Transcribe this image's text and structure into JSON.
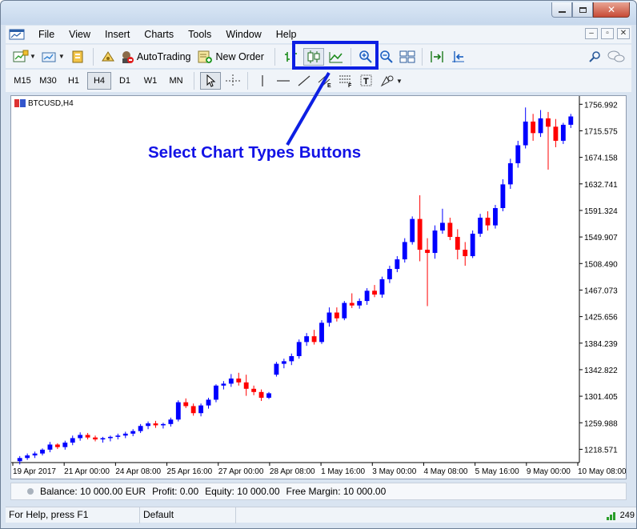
{
  "window": {
    "minimize_label": "–",
    "maximize_label": "□",
    "close_label": "✕"
  },
  "menubar": {
    "items": [
      "File",
      "View",
      "Insert",
      "Charts",
      "Tools",
      "Window",
      "Help"
    ]
  },
  "toolbar": {
    "autotrading_label": "AutoTrading",
    "new_order_label": "New Order"
  },
  "timeframes": [
    "M15",
    "M30",
    "H1",
    "H4",
    "D1",
    "W1",
    "MN"
  ],
  "active_timeframe": "H4",
  "chart": {
    "symbol_label": "BTCUSD,H4",
    "annotation": "Select Chart Types Buttons"
  },
  "chart_data": {
    "type": "candlestick",
    "title": "BTCUSD,H4",
    "y_ticks": [
      "1756.992",
      "1715.575",
      "1674.158",
      "1632.741",
      "1591.324",
      "1549.907",
      "1508.490",
      "1467.073",
      "1425.656",
      "1384.239",
      "1342.822",
      "1301.405",
      "1259.988",
      "1218.571"
    ],
    "x_ticks": [
      "19 Apr 2017",
      "21 Apr 00:00",
      "24 Apr 08:00",
      "25 Apr 16:00",
      "27 Apr 00:00",
      "28 Apr 08:00",
      "1 May 16:00",
      "3 May 00:00",
      "4 May 08:00",
      "5 May 16:00",
      "9 May 00:00",
      "10 May 08:00"
    ],
    "ylim": [
      1197.86,
      1767.35
    ],
    "colors": {
      "up": "#0000ff",
      "down": "#ff0000"
    },
    "grid": false,
    "ohlc": [
      [
        1200,
        1208,
        1195,
        1205
      ],
      [
        1205,
        1212,
        1202,
        1209
      ],
      [
        1209,
        1215,
        1205,
        1212
      ],
      [
        1212,
        1220,
        1209,
        1218
      ],
      [
        1218,
        1230,
        1214,
        1226
      ],
      [
        1226,
        1228,
        1219,
        1222
      ],
      [
        1222,
        1232,
        1218,
        1229
      ],
      [
        1229,
        1240,
        1225,
        1236
      ],
      [
        1236,
        1245,
        1232,
        1241
      ],
      [
        1241,
        1244,
        1234,
        1237
      ],
      [
        1237,
        1240,
        1231,
        1234
      ],
      [
        1234,
        1238,
        1229,
        1236
      ],
      [
        1236,
        1240,
        1231,
        1238
      ],
      [
        1238,
        1243,
        1234,
        1240
      ],
      [
        1240,
        1246,
        1236,
        1243
      ],
      [
        1243,
        1250,
        1239,
        1247
      ],
      [
        1247,
        1258,
        1244,
        1255
      ],
      [
        1255,
        1262,
        1250,
        1259
      ],
      [
        1259,
        1263,
        1252,
        1256
      ],
      [
        1256,
        1260,
        1251,
        1258
      ],
      [
        1258,
        1268,
        1254,
        1265
      ],
      [
        1265,
        1295,
        1262,
        1292
      ],
      [
        1292,
        1298,
        1283,
        1286
      ],
      [
        1286,
        1290,
        1271,
        1275
      ],
      [
        1275,
        1290,
        1270,
        1287
      ],
      [
        1287,
        1299,
        1282,
        1296
      ],
      [
        1296,
        1320,
        1292,
        1318
      ],
      [
        1318,
        1325,
        1312,
        1321
      ],
      [
        1321,
        1336,
        1316,
        1329
      ],
      [
        1329,
        1338,
        1318,
        1323
      ],
      [
        1323,
        1335,
        1302,
        1313
      ],
      [
        1313,
        1318,
        1303,
        1308
      ],
      [
        1308,
        1312,
        1294,
        1299
      ],
      [
        1299,
        1308,
        1297,
        1306
      ],
      [
        1335,
        1355,
        1332,
        1352
      ],
      [
        1352,
        1360,
        1345,
        1356
      ],
      [
        1356,
        1368,
        1350,
        1364
      ],
      [
        1364,
        1390,
        1360,
        1386
      ],
      [
        1386,
        1400,
        1380,
        1395
      ],
      [
        1395,
        1405,
        1382,
        1386
      ],
      [
        1386,
        1420,
        1383,
        1416
      ],
      [
        1416,
        1440,
        1410,
        1432
      ],
      [
        1432,
        1440,
        1418,
        1423
      ],
      [
        1423,
        1450,
        1420,
        1447
      ],
      [
        1447,
        1462,
        1439,
        1443
      ],
      [
        1443,
        1454,
        1438,
        1450
      ],
      [
        1450,
        1470,
        1444,
        1466
      ],
      [
        1466,
        1475,
        1456,
        1460
      ],
      [
        1460,
        1488,
        1455,
        1484
      ],
      [
        1484,
        1505,
        1478,
        1500
      ],
      [
        1500,
        1520,
        1495,
        1515
      ],
      [
        1515,
        1548,
        1510,
        1542
      ],
      [
        1542,
        1582,
        1538,
        1578
      ],
      [
        1578,
        1615,
        1512,
        1530
      ],
      [
        1530,
        1548,
        1442,
        1525
      ],
      [
        1525,
        1568,
        1516,
        1560
      ],
      [
        1560,
        1594,
        1555,
        1572
      ],
      [
        1572,
        1580,
        1545,
        1550
      ],
      [
        1550,
        1562,
        1515,
        1530
      ],
      [
        1530,
        1542,
        1505,
        1520
      ],
      [
        1520,
        1560,
        1517,
        1555
      ],
      [
        1555,
        1586,
        1550,
        1580
      ],
      [
        1580,
        1590,
        1560,
        1568
      ],
      [
        1568,
        1600,
        1563,
        1595
      ],
      [
        1595,
        1640,
        1590,
        1632
      ],
      [
        1632,
        1672,
        1625,
        1665
      ],
      [
        1665,
        1700,
        1658,
        1693
      ],
      [
        1693,
        1752,
        1688,
        1730
      ],
      [
        1730,
        1742,
        1700,
        1712
      ],
      [
        1712,
        1748,
        1706,
        1735
      ],
      [
        1735,
        1745,
        1655,
        1722
      ],
      [
        1722,
        1734,
        1690,
        1700
      ],
      [
        1700,
        1728,
        1695,
        1725
      ],
      [
        1725,
        1742,
        1720,
        1738
      ]
    ]
  },
  "account": {
    "balance": "Balance: 10 000.00 EUR",
    "profit": "Profit: 0.00",
    "equity": "Equity: 10 000.00",
    "free_margin": "Free Margin: 10 000.00"
  },
  "status": {
    "help": "For Help, press F1",
    "profile": "Default",
    "counter": "249"
  }
}
